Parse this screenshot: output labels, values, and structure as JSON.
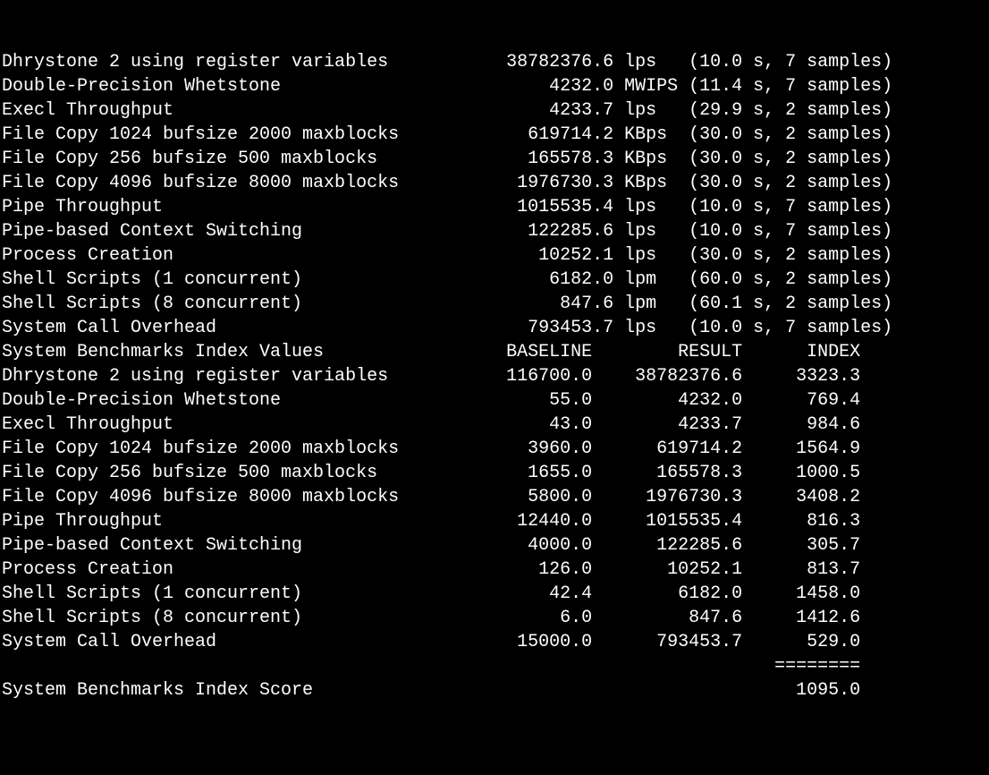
{
  "raw_section": {
    "rows": [
      {
        "name": "Dhrystone 2 using register variables",
        "value": "38782376.6",
        "unit": "lps",
        "time": "10.0",
        "samples": "7"
      },
      {
        "name": "Double-Precision Whetstone",
        "value": "4232.0",
        "unit": "MWIPS",
        "time": "11.4",
        "samples": "7"
      },
      {
        "name": "Execl Throughput",
        "value": "4233.7",
        "unit": "lps",
        "time": "29.9",
        "samples": "2"
      },
      {
        "name": "File Copy 1024 bufsize 2000 maxblocks",
        "value": "619714.2",
        "unit": "KBps",
        "time": "30.0",
        "samples": "2"
      },
      {
        "name": "File Copy 256 bufsize 500 maxblocks",
        "value": "165578.3",
        "unit": "KBps",
        "time": "30.0",
        "samples": "2"
      },
      {
        "name": "File Copy 4096 bufsize 8000 maxblocks",
        "value": "1976730.3",
        "unit": "KBps",
        "time": "30.0",
        "samples": "2"
      },
      {
        "name": "Pipe Throughput",
        "value": "1015535.4",
        "unit": "lps",
        "time": "10.0",
        "samples": "7"
      },
      {
        "name": "Pipe-based Context Switching",
        "value": "122285.6",
        "unit": "lps",
        "time": "10.0",
        "samples": "7"
      },
      {
        "name": "Process Creation",
        "value": "10252.1",
        "unit": "lps",
        "time": "30.0",
        "samples": "2"
      },
      {
        "name": "Shell Scripts (1 concurrent)",
        "value": "6182.0",
        "unit": "lpm",
        "time": "60.0",
        "samples": "2"
      },
      {
        "name": "Shell Scripts (8 concurrent)",
        "value": "847.6",
        "unit": "lpm",
        "time": "60.1",
        "samples": "2"
      },
      {
        "name": "System Call Overhead",
        "value": "793453.7",
        "unit": "lps",
        "time": "10.0",
        "samples": "7"
      }
    ]
  },
  "index_section": {
    "header": {
      "title": "System Benchmarks Index Values",
      "col1": "BASELINE",
      "col2": "RESULT",
      "col3": "INDEX"
    },
    "rows": [
      {
        "name": "Dhrystone 2 using register variables",
        "baseline": "116700.0",
        "result": "38782376.6",
        "index": "3323.3"
      },
      {
        "name": "Double-Precision Whetstone",
        "baseline": "55.0",
        "result": "4232.0",
        "index": "769.4"
      },
      {
        "name": "Execl Throughput",
        "baseline": "43.0",
        "result": "4233.7",
        "index": "984.6"
      },
      {
        "name": "File Copy 1024 bufsize 2000 maxblocks",
        "baseline": "3960.0",
        "result": "619714.2",
        "index": "1564.9"
      },
      {
        "name": "File Copy 256 bufsize 500 maxblocks",
        "baseline": "1655.0",
        "result": "165578.3",
        "index": "1000.5"
      },
      {
        "name": "File Copy 4096 bufsize 8000 maxblocks",
        "baseline": "5800.0",
        "result": "1976730.3",
        "index": "3408.2"
      },
      {
        "name": "Pipe Throughput",
        "baseline": "12440.0",
        "result": "1015535.4",
        "index": "816.3"
      },
      {
        "name": "Pipe-based Context Switching",
        "baseline": "4000.0",
        "result": "122285.6",
        "index": "305.7"
      },
      {
        "name": "Process Creation",
        "baseline": "126.0",
        "result": "10252.1",
        "index": "813.7"
      },
      {
        "name": "Shell Scripts (1 concurrent)",
        "baseline": "42.4",
        "result": "6182.0",
        "index": "1458.0"
      },
      {
        "name": "Shell Scripts (8 concurrent)",
        "baseline": "6.0",
        "result": "847.6",
        "index": "1412.6"
      },
      {
        "name": "System Call Overhead",
        "baseline": "15000.0",
        "result": "793453.7",
        "index": "529.0"
      }
    ]
  },
  "score_line": {
    "label": "System Benchmarks Index Score",
    "value": "1095.0"
  },
  "sep": "========"
}
